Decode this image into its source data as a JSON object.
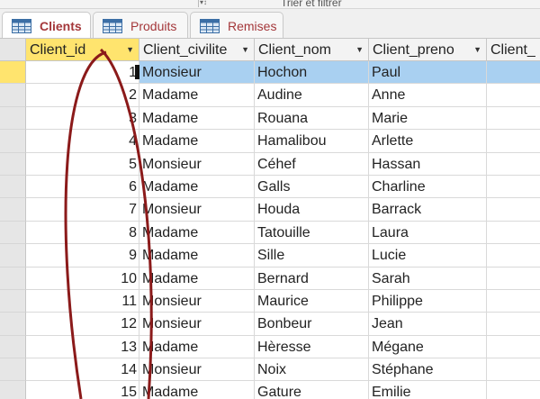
{
  "ribbon": {
    "group_text": "Trier et filtrer"
  },
  "tabs": [
    {
      "label": "Clients",
      "active": true
    },
    {
      "label": "Produits",
      "active": false
    },
    {
      "label": "Remises",
      "active": false
    }
  ],
  "columns": [
    "Client_id",
    "Client_civilite",
    "Client_nom",
    "Client_preno",
    "Client_"
  ],
  "rows": [
    {
      "id": "1",
      "civilite": "Monsieur",
      "nom": "Hochon",
      "prenom": "Paul"
    },
    {
      "id": "2",
      "civilite": "Madame",
      "nom": "Audine",
      "prenom": "Anne"
    },
    {
      "id": "3",
      "civilite": "Madame",
      "nom": "Rouana",
      "prenom": "Marie"
    },
    {
      "id": "4",
      "civilite": "Madame",
      "nom": "Hamalibou",
      "prenom": "Arlette"
    },
    {
      "id": "5",
      "civilite": "Monsieur",
      "nom": "Céhef",
      "prenom": "Hassan"
    },
    {
      "id": "6",
      "civilite": "Madame",
      "nom": "Galls",
      "prenom": "Charline"
    },
    {
      "id": "7",
      "civilite": "Monsieur",
      "nom": "Houda",
      "prenom": "Barrack"
    },
    {
      "id": "8",
      "civilite": "Madame",
      "nom": "Tatouille",
      "prenom": "Laura"
    },
    {
      "id": "9",
      "civilite": "Madame",
      "nom": "Sille",
      "prenom": "Lucie"
    },
    {
      "id": "10",
      "civilite": "Madame",
      "nom": "Bernard",
      "prenom": "Sarah"
    },
    {
      "id": "11",
      "civilite": "Monsieur",
      "nom": "Maurice",
      "prenom": "Philippe"
    },
    {
      "id": "12",
      "civilite": "Monsieur",
      "nom": "Bonbeur",
      "prenom": "Jean"
    },
    {
      "id": "13",
      "civilite": "Madame",
      "nom": "Hèresse",
      "prenom": "Mégane"
    },
    {
      "id": "14",
      "civilite": "Monsieur",
      "nom": "Noix",
      "prenom": "Stéphane"
    },
    {
      "id": "15",
      "civilite": "Madame",
      "nom": "Gature",
      "prenom": "Emilie"
    }
  ],
  "colors": {
    "tab_text": "#a4373a",
    "selected_header": "#ffe46e",
    "current_row": "#a9d0f1",
    "annotation": "#8b1a1a"
  },
  "icons": {
    "tab": "table-icon",
    "header_dropdown": "chevron-down-icon"
  }
}
